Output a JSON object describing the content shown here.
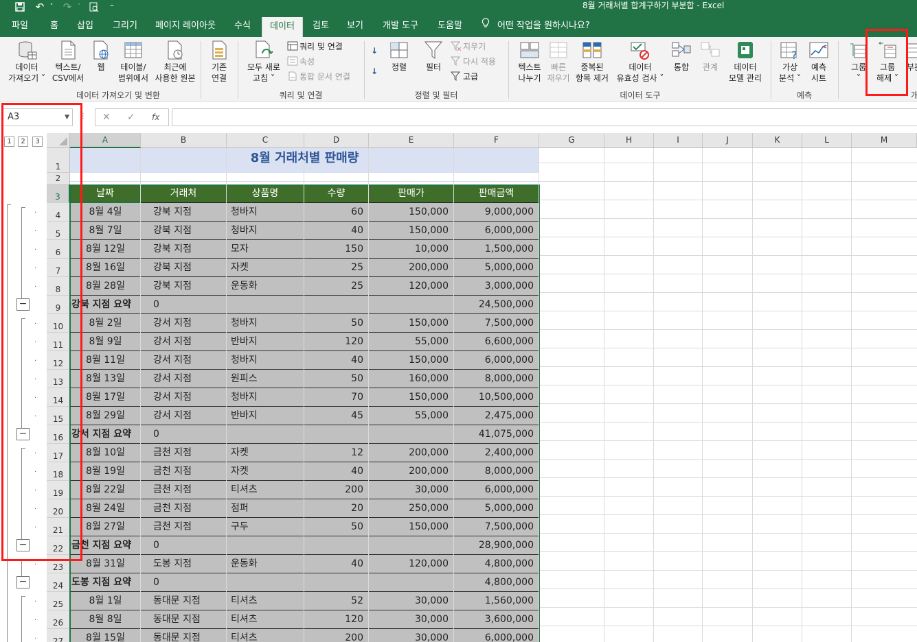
{
  "window": {
    "title": "8월 거래처별 합계구하기 부분합  -  Excel",
    "qa_icons": [
      "save-icon",
      "undo-icon",
      "redo-icon",
      "preview-icon",
      "customize-icon"
    ]
  },
  "tabs": [
    "파일",
    "홈",
    "삽입",
    "그리기",
    "페이지 레이아웃",
    "수식",
    "데이터",
    "검토",
    "보기",
    "개발 도구",
    "도움말"
  ],
  "active_tab": "데이터",
  "tell_me": "어떤 작업을 원하시나요?",
  "ribbon": {
    "get_data": {
      "l1": "데이터",
      "l2": "가져오기 ˅"
    },
    "from_text": {
      "l1": "텍스트/",
      "l2": "CSV에서"
    },
    "from_web": {
      "l1": "웹",
      "l2": ""
    },
    "from_table": {
      "l1": "테이블/",
      "l2": "범위에서"
    },
    "recent": {
      "l1": "최근에",
      "l2": "사용한 원본"
    },
    "existing": {
      "l1": "기존",
      "l2": "연결"
    },
    "group1_label": "데이터 가져오기 및 변환",
    "refresh_all": {
      "l1": "모두 새로",
      "l2": "고침 ˅"
    },
    "queries": "쿼리 및 연결",
    "properties": "속성",
    "edit_links": "통합 문서 연결",
    "group2_label": "쿼리 및 연결",
    "sort": {
      "l1": "정렬",
      "l2": ""
    },
    "filter": {
      "l1": "필터",
      "l2": ""
    },
    "clear": "지우기",
    "reapply": "다시 적용",
    "advanced": "고급",
    "group3_label": "정렬 및 필터",
    "text_to_columns": {
      "l1": "텍스트",
      "l2": "나누기"
    },
    "flash_fill": {
      "l1": "빠른",
      "l2": "채우기"
    },
    "remove_dup": {
      "l1": "중복된",
      "l2": "항목 제거"
    },
    "validation": {
      "l1": "데이터",
      "l2": "유효성 검사 ˅"
    },
    "consolidate": {
      "l1": "통합",
      "l2": ""
    },
    "relationships": {
      "l1": "관계",
      "l2": ""
    },
    "data_model": {
      "l1": "데이터",
      "l2": "모델 관리"
    },
    "group4_label": "데이터 도구",
    "what_if": {
      "l1": "가상",
      "l2": "분석 ˅"
    },
    "forecast": {
      "l1": "예측",
      "l2": "시트"
    },
    "group5_label": "예측",
    "group_btn": {
      "l1": "그룹",
      "l2": "˅"
    },
    "ungroup_btn": {
      "l1": "그룹",
      "l2": "해제 ˅"
    },
    "subtotal_btn": {
      "l1": "부분",
      "l2": ""
    },
    "group6_label": "개"
  },
  "formula_bar": {
    "name_box": "A3",
    "cancel": "✕",
    "enter": "✓",
    "fx": "fx",
    "formula": ""
  },
  "outline_levels": [
    "1",
    "2",
    "3"
  ],
  "columns": [
    "A",
    "B",
    "C",
    "D",
    "E",
    "F",
    "G",
    "H",
    "I",
    "J",
    "K",
    "L",
    "M"
  ],
  "sheet": {
    "title": "8월 거래처별 판매량",
    "headers": [
      "날짜",
      "거래처",
      "상품명",
      "수량",
      "판매가",
      "판매금액"
    ],
    "rows": [
      {
        "row": "4",
        "date": "8월 4일",
        "branch": "강북 지점",
        "product": "청바지",
        "qty": "60",
        "price": "150,000",
        "amount": "9,000,000"
      },
      {
        "row": "5",
        "date": "8월 7일",
        "branch": "강북 지점",
        "product": "청바지",
        "qty": "40",
        "price": "150,000",
        "amount": "6,000,000"
      },
      {
        "row": "6",
        "date": "8월 12일",
        "branch": "강북 지점",
        "product": "모자",
        "qty": "150",
        "price": "10,000",
        "amount": "1,500,000"
      },
      {
        "row": "7",
        "date": "8월 16일",
        "branch": "강북 지점",
        "product": "자켓",
        "qty": "25",
        "price": "200,000",
        "amount": "5,000,000"
      },
      {
        "row": "8",
        "date": "8월 28일",
        "branch": "강북 지점",
        "product": "운동화",
        "qty": "25",
        "price": "120,000",
        "amount": "3,000,000"
      },
      {
        "row": "9",
        "summary": true,
        "date": "강북 지점 요약",
        "branch": "0",
        "product": "",
        "qty": "",
        "price": "",
        "amount": "24,500,000"
      },
      {
        "row": "10",
        "date": "8월 2일",
        "branch": "강서 지점",
        "product": "청바지",
        "qty": "50",
        "price": "150,000",
        "amount": "7,500,000"
      },
      {
        "row": "11",
        "date": "8월 9일",
        "branch": "강서 지점",
        "product": "반바지",
        "qty": "120",
        "price": "55,000",
        "amount": "6,600,000"
      },
      {
        "row": "12",
        "date": "8월 11일",
        "branch": "강서 지점",
        "product": "청바지",
        "qty": "40",
        "price": "150,000",
        "amount": "6,000,000"
      },
      {
        "row": "13",
        "date": "8월 13일",
        "branch": "강서 지점",
        "product": "원피스",
        "qty": "50",
        "price": "160,000",
        "amount": "8,000,000"
      },
      {
        "row": "14",
        "date": "8월 17일",
        "branch": "강서 지점",
        "product": "청바지",
        "qty": "70",
        "price": "150,000",
        "amount": "10,500,000"
      },
      {
        "row": "15",
        "date": "8월 29일",
        "branch": "강서 지점",
        "product": "반바지",
        "qty": "45",
        "price": "55,000",
        "amount": "2,475,000"
      },
      {
        "row": "16",
        "summary": true,
        "date": "강서 지점 요약",
        "branch": "0",
        "product": "",
        "qty": "",
        "price": "",
        "amount": "41,075,000"
      },
      {
        "row": "17",
        "date": "8월 10일",
        "branch": "금천 지점",
        "product": "자켓",
        "qty": "12",
        "price": "200,000",
        "amount": "2,400,000"
      },
      {
        "row": "18",
        "date": "8월 19일",
        "branch": "금천 지점",
        "product": "자켓",
        "qty": "40",
        "price": "200,000",
        "amount": "8,000,000"
      },
      {
        "row": "19",
        "date": "8월 22일",
        "branch": "금천 지점",
        "product": "티셔츠",
        "qty": "200",
        "price": "30,000",
        "amount": "6,000,000"
      },
      {
        "row": "20",
        "date": "8월 24일",
        "branch": "금천 지점",
        "product": "점퍼",
        "qty": "20",
        "price": "250,000",
        "amount": "5,000,000"
      },
      {
        "row": "21",
        "date": "8월 27일",
        "branch": "금천 지점",
        "product": "구두",
        "qty": "50",
        "price": "150,000",
        "amount": "7,500,000"
      },
      {
        "row": "22",
        "summary": true,
        "date": "금천 지점 요약",
        "branch": "0",
        "product": "",
        "qty": "",
        "price": "",
        "amount": "28,900,000"
      },
      {
        "row": "23",
        "date": "8월 31일",
        "branch": "도봉 지점",
        "product": "운동화",
        "qty": "40",
        "price": "120,000",
        "amount": "4,800,000"
      },
      {
        "row": "24",
        "summary": true,
        "date": "도봉 지점 요약",
        "branch": "0",
        "product": "",
        "qty": "",
        "price": "",
        "amount": "4,800,000"
      },
      {
        "row": "25",
        "date": "8월 1일",
        "branch": "동대문 지점",
        "product": "티셔츠",
        "qty": "52",
        "price": "30,000",
        "amount": "1,560,000"
      },
      {
        "row": "26",
        "date": "8월 8일",
        "branch": "동대문 지점",
        "product": "티셔츠",
        "qty": "120",
        "price": "30,000",
        "amount": "3,600,000"
      },
      {
        "row": "27",
        "date": "8월 15일",
        "branch": "동대문 지점",
        "product": "티셔츠",
        "qty": "200",
        "price": "30,000",
        "amount": "6,000,000"
      }
    ]
  },
  "colors": {
    "excel_green": "#217346",
    "header_green": "#3f6d2a",
    "title_fill": "#d9e1f2",
    "data_fill": "#c0c0c0",
    "highlight_red": "#ff1a1a"
  }
}
